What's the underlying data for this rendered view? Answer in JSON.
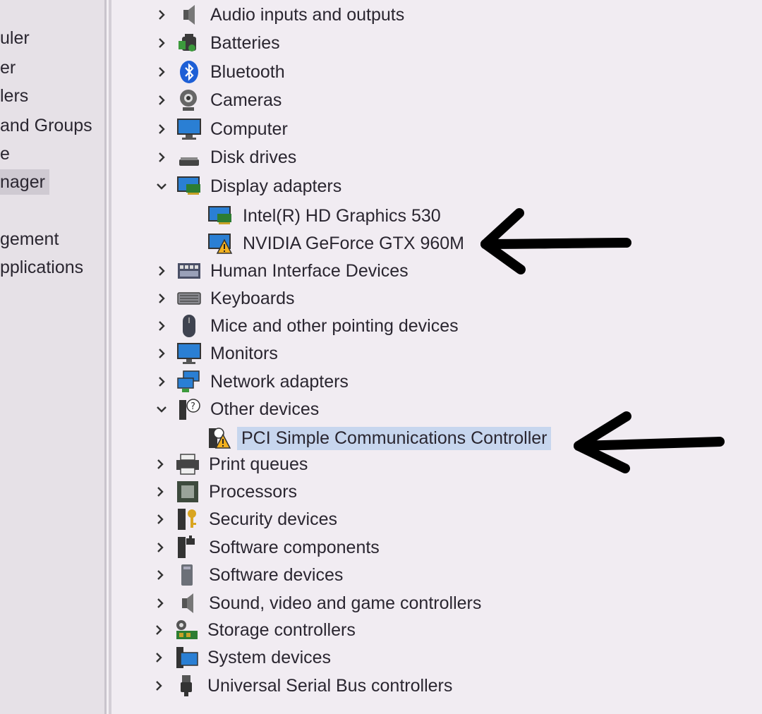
{
  "sidebar": {
    "items": [
      {
        "label": "uler",
        "selected": false
      },
      {
        "label": "er",
        "selected": false
      },
      {
        "label": "lers",
        "selected": false
      },
      {
        "label": "and Groups",
        "selected": false
      },
      {
        "label": "e",
        "selected": false
      },
      {
        "label": "nager",
        "selected": true
      },
      {
        "label": "gement",
        "selected": false
      },
      {
        "label": "pplications",
        "selected": false
      }
    ]
  },
  "tree": {
    "nodes": [
      {
        "label": "Audio inputs and outputs",
        "icon": "speaker-icon",
        "expanded": false
      },
      {
        "label": "Batteries",
        "icon": "battery-icon",
        "expanded": false
      },
      {
        "label": "Bluetooth",
        "icon": "bluetooth-icon",
        "expanded": false
      },
      {
        "label": "Cameras",
        "icon": "camera-icon",
        "expanded": false
      },
      {
        "label": "Computer",
        "icon": "computer-icon",
        "expanded": false
      },
      {
        "label": "Disk drives",
        "icon": "disk-drive-icon",
        "expanded": false
      },
      {
        "label": "Display adapters",
        "icon": "display-adapter-icon",
        "expanded": true
      },
      {
        "label": "Intel(R) HD Graphics 530",
        "icon": "display-adapter-icon",
        "child": true
      },
      {
        "label": "NVIDIA GeForce GTX 960M",
        "icon": "display-adapter-warning-icon",
        "child": true
      },
      {
        "label": "Human Interface Devices",
        "icon": "hid-icon",
        "expanded": false
      },
      {
        "label": "Keyboards",
        "icon": "keyboard-icon",
        "expanded": false
      },
      {
        "label": "Mice and other pointing devices",
        "icon": "mouse-icon",
        "expanded": false
      },
      {
        "label": "Monitors",
        "icon": "monitor-icon",
        "expanded": false
      },
      {
        "label": "Network adapters",
        "icon": "network-icon",
        "expanded": false
      },
      {
        "label": "Other devices",
        "icon": "unknown-device-icon",
        "expanded": true
      },
      {
        "label": "PCI Simple Communications Controller",
        "icon": "device-warning-icon",
        "child": true,
        "selected": true
      },
      {
        "label": "Print queues",
        "icon": "printer-icon",
        "expanded": false
      },
      {
        "label": "Processors",
        "icon": "processor-icon",
        "expanded": false
      },
      {
        "label": "Security devices",
        "icon": "security-key-icon",
        "expanded": false
      },
      {
        "label": "Software components",
        "icon": "software-component-icon",
        "expanded": false
      },
      {
        "label": "Software devices",
        "icon": "software-device-icon",
        "expanded": false
      },
      {
        "label": "Sound, video and game controllers",
        "icon": "speaker-icon",
        "expanded": false
      },
      {
        "label": "Storage controllers",
        "icon": "storage-controller-icon",
        "expanded": false
      },
      {
        "label": "System devices",
        "icon": "system-devices-icon",
        "expanded": false
      },
      {
        "label": "Universal Serial Bus controllers",
        "icon": "usb-icon",
        "expanded": false
      }
    ]
  },
  "colors": {
    "background": "#f1ecf2",
    "selection": "#c7d6ee",
    "annotation_arrow": "#000000"
  }
}
